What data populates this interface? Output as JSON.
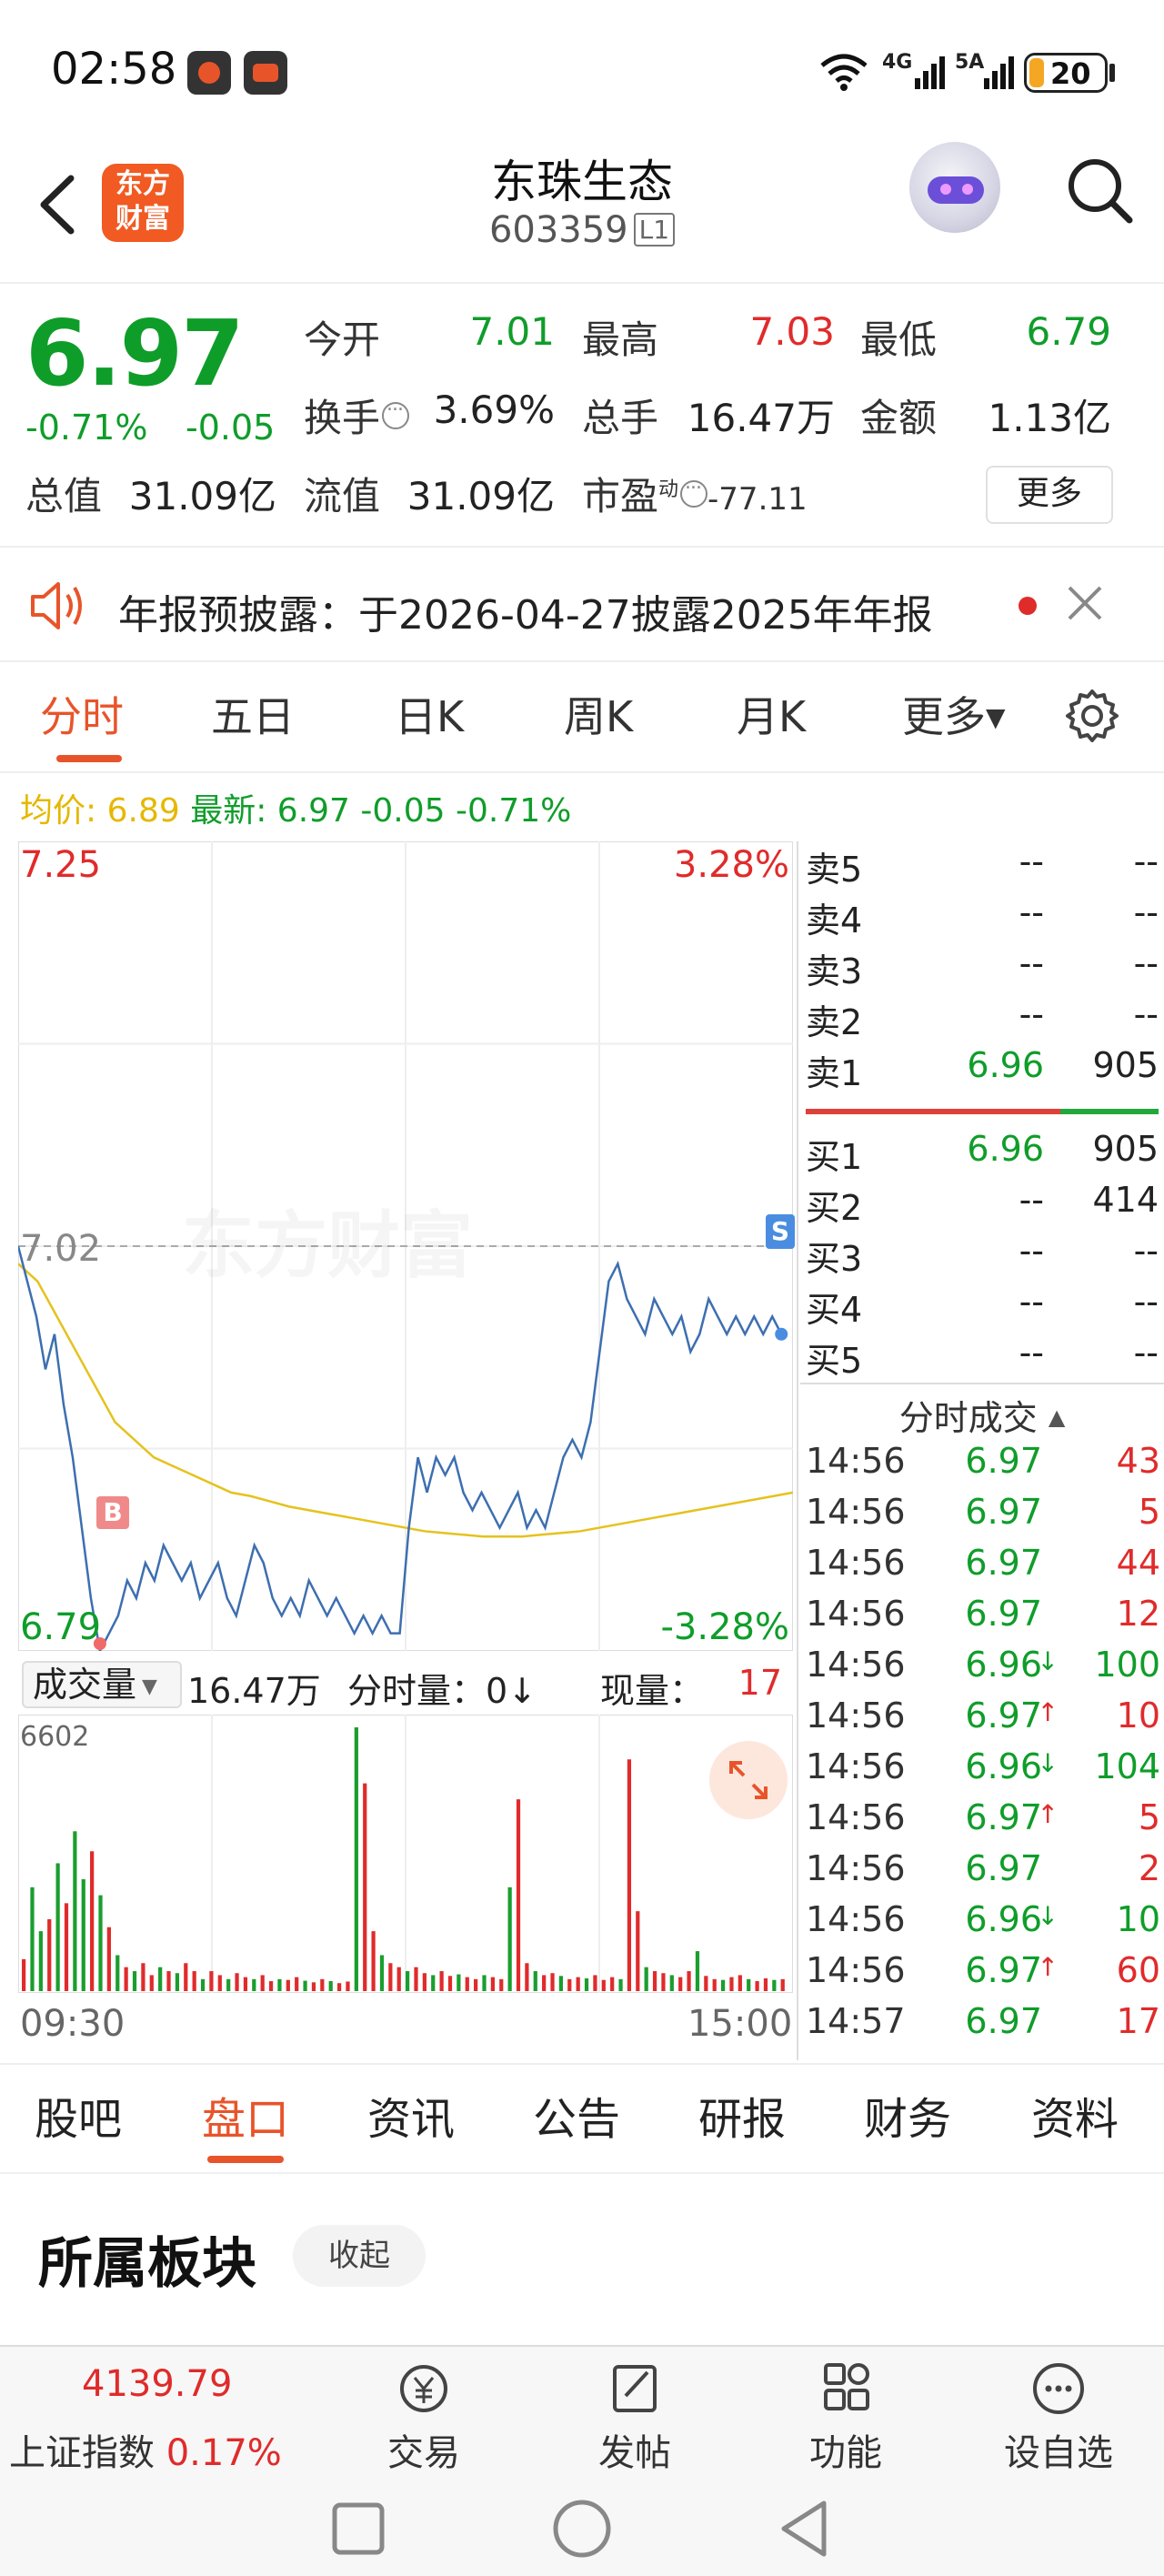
{
  "status_bar": {
    "time": "02:58",
    "net_1": "4G",
    "net_2": "5A",
    "battery": "20"
  },
  "header": {
    "logo_text": "东方财富",
    "stock_name": "东珠生态",
    "stock_code": "603359",
    "level_badge": "L1"
  },
  "quote": {
    "price": "6.97",
    "change_pct": "-0.71%",
    "change_amt": "-0.05",
    "open_label": "今开",
    "open": "7.01",
    "high_label": "最高",
    "high": "7.03",
    "low_label": "最低",
    "low": "6.79",
    "turnover_label": "换手",
    "turnover": "3.69%",
    "volume_label": "总手",
    "volume": "16.47万",
    "amount_label": "金额",
    "amount": "1.13亿",
    "total_cap_label": "总值",
    "total_cap": "31.09亿",
    "float_cap_label": "流值",
    "float_cap": "31.09亿",
    "pe_label": "市盈",
    "pe_sup": "动",
    "pe": "-77.11",
    "more_label": "更多"
  },
  "notice": {
    "text": "年报预披露：于2026-04-27披露2025年年报"
  },
  "chart_tabs": [
    "分时",
    "五日",
    "日K",
    "周K",
    "月K",
    "更多"
  ],
  "legend": {
    "avg_label": "均价:",
    "avg": "6.89",
    "latest_label": "最新:",
    "latest": "6.97 -0.05 -0.71%"
  },
  "chart": {
    "watermark": "东方财富",
    "y_top": "7.25",
    "y_top_pct": "3.28%",
    "y_bottom": "6.79",
    "y_bottom_pct": "-3.28%",
    "ref_price": "7.02",
    "s_badge": "S",
    "b_badge": "B"
  },
  "chart_data": {
    "type": "line",
    "x_range": [
      "09:30",
      "15:00"
    ],
    "ylim": [
      6.79,
      7.25
    ],
    "ref_price": 7.02,
    "series": [
      {
        "name": "最新",
        "color": "#3d6fb0",
        "values": [
          7.02,
          7.0,
          6.98,
          6.95,
          6.97,
          6.93,
          6.9,
          6.86,
          6.82,
          6.79,
          6.8,
          6.81,
          6.83,
          6.82,
          6.84,
          6.83,
          6.85,
          6.84,
          6.83,
          6.84,
          6.82,
          6.83,
          6.84,
          6.82,
          6.81,
          6.83,
          6.85,
          6.84,
          6.82,
          6.81,
          6.82,
          6.81,
          6.83,
          6.82,
          6.81,
          6.82,
          6.81,
          6.8,
          6.81,
          6.8,
          6.81,
          6.8,
          6.8,
          6.86,
          6.9,
          6.88,
          6.9,
          6.89,
          6.9,
          6.88,
          6.87,
          6.88,
          6.87,
          6.86,
          6.87,
          6.88,
          6.86,
          6.87,
          6.86,
          6.88,
          6.9,
          6.91,
          6.9,
          6.92,
          6.96,
          7.0,
          7.01,
          6.99,
          6.98,
          6.97,
          6.99,
          6.98,
          6.97,
          6.98,
          6.96,
          6.97,
          6.99,
          6.98,
          6.97,
          6.98,
          6.97,
          6.98,
          6.97,
          6.98,
          6.97
        ]
      },
      {
        "name": "均价",
        "color": "#e5c21e",
        "values": [
          7.01,
          7.0,
          6.98,
          6.96,
          6.94,
          6.92,
          6.91,
          6.9,
          6.895,
          6.89,
          6.885,
          6.88,
          6.878,
          6.875,
          6.872,
          6.87,
          6.868,
          6.866,
          6.864,
          6.862,
          6.86,
          6.858,
          6.857,
          6.856,
          6.855,
          6.855,
          6.855,
          6.856,
          6.857,
          6.858,
          6.86,
          6.862,
          6.864,
          6.866,
          6.868,
          6.87,
          6.872,
          6.874,
          6.876,
          6.878,
          6.88
        ]
      }
    ]
  },
  "volume": {
    "selector_label": "成交量",
    "total": "16.47万",
    "minute_label": "分时量：",
    "minute_value": "0↓",
    "now_label": "现量：",
    "now_value": "17",
    "max_label": "6602",
    "time_start": "09:30",
    "time_end": "15:00",
    "values": [
      800,
      2600,
      1500,
      1800,
      3200,
      2200,
      4000,
      2800,
      3500,
      2400,
      1600,
      900,
      600,
      500,
      700,
      400,
      600,
      500,
      450,
      700,
      500,
      300,
      500,
      400,
      300,
      450,
      350,
      300,
      400,
      250,
      300,
      280,
      350,
      260,
      220,
      300,
      250,
      200,
      240,
      6602,
      5200,
      1500,
      900,
      700,
      600,
      500,
      600,
      450,
      400,
      500,
      380,
      420,
      350,
      300,
      400,
      350,
      300,
      2600,
      4800,
      700,
      500,
      400,
      450,
      380,
      300,
      350,
      320,
      400,
      280,
      350,
      300,
      5800,
      2000,
      600,
      500,
      450,
      400,
      350,
      500,
      1000,
      380,
      300,
      280,
      350,
      400,
      300,
      250,
      320,
      280,
      300
    ],
    "directions": [
      "r",
      "g",
      "g",
      "r",
      "g",
      "r",
      "g",
      "g",
      "r",
      "g",
      "r",
      "g",
      "r",
      "g",
      "r",
      "r",
      "g",
      "r",
      "g",
      "r",
      "r",
      "g",
      "r",
      "r",
      "g",
      "r",
      "r",
      "g",
      "r",
      "r",
      "g",
      "r",
      "r",
      "g",
      "r",
      "r",
      "g",
      "r",
      "r",
      "g",
      "r",
      "r",
      "g",
      "r",
      "r",
      "g",
      "r",
      "r",
      "g",
      "r",
      "r",
      "g",
      "r",
      "r",
      "g",
      "r",
      "r",
      "g",
      "r",
      "r",
      "g",
      "r",
      "r",
      "g",
      "r",
      "r",
      "g",
      "r",
      "r",
      "r",
      "g",
      "r",
      "r",
      "g",
      "r",
      "r",
      "g",
      "r",
      "r",
      "g",
      "r",
      "r",
      "g",
      "r",
      "r",
      "g",
      "r",
      "r",
      "g",
      "r"
    ]
  },
  "order_book": {
    "asks": [
      {
        "label": "卖5",
        "price": "--",
        "qty": "--"
      },
      {
        "label": "卖4",
        "price": "--",
        "qty": "--"
      },
      {
        "label": "卖3",
        "price": "--",
        "qty": "--"
      },
      {
        "label": "卖2",
        "price": "--",
        "qty": "--"
      },
      {
        "label": "卖1",
        "price": "6.96",
        "qty": "905"
      }
    ],
    "bids": [
      {
        "label": "买1",
        "price": "6.96",
        "qty": "905"
      },
      {
        "label": "买2",
        "price": "--",
        "qty": "414"
      },
      {
        "label": "买3",
        "price": "--",
        "qty": "--"
      },
      {
        "label": "买4",
        "price": "--",
        "qty": "--"
      },
      {
        "label": "买5",
        "price": "--",
        "qty": "--"
      }
    ]
  },
  "ticks": {
    "header": "分时成交",
    "rows": [
      {
        "time": "14:56",
        "price": "6.97",
        "arrow": "",
        "vol": "43"
      },
      {
        "time": "14:56",
        "price": "6.97",
        "arrow": "",
        "vol": "5"
      },
      {
        "time": "14:56",
        "price": "6.97",
        "arrow": "",
        "vol": "44"
      },
      {
        "time": "14:56",
        "price": "6.97",
        "arrow": "",
        "vol": "12"
      },
      {
        "time": "14:56",
        "price": "6.96",
        "arrow": "↓",
        "vol": "100"
      },
      {
        "time": "14:56",
        "price": "6.97",
        "arrow": "↑",
        "vol": "10"
      },
      {
        "time": "14:56",
        "price": "6.96",
        "arrow": "↓",
        "vol": "104"
      },
      {
        "time": "14:56",
        "price": "6.97",
        "arrow": "↑",
        "vol": "5"
      },
      {
        "time": "14:56",
        "price": "6.97",
        "arrow": "",
        "vol": "2"
      },
      {
        "time": "14:56",
        "price": "6.96",
        "arrow": "↓",
        "vol": "10"
      },
      {
        "time": "14:56",
        "price": "6.97",
        "arrow": "↑",
        "vol": "60"
      },
      {
        "time": "14:57",
        "price": "6.97",
        "arrow": "",
        "vol": "17"
      }
    ]
  },
  "section_tabs": [
    "股吧",
    "盘口",
    "资讯",
    "公告",
    "研报",
    "财务",
    "资料"
  ],
  "sector": {
    "title": "所属板块",
    "collapse_label": "收起"
  },
  "bottom_bar": {
    "index_value": "4139.79",
    "index_name": "上证指数",
    "index_pct": "0.17%",
    "nav": [
      {
        "label": "交易",
        "icon": "trade-icon"
      },
      {
        "label": "发帖",
        "icon": "edit-icon"
      },
      {
        "label": "功能",
        "icon": "grid-icon"
      },
      {
        "label": "设自选",
        "icon": "more-circle-icon"
      }
    ]
  },
  "colors": {
    "up": "#e02b2b",
    "down": "#0f9d2a",
    "accent": "#e8542a",
    "avg_line": "#e5c21e",
    "price_line": "#3d6fb0"
  }
}
